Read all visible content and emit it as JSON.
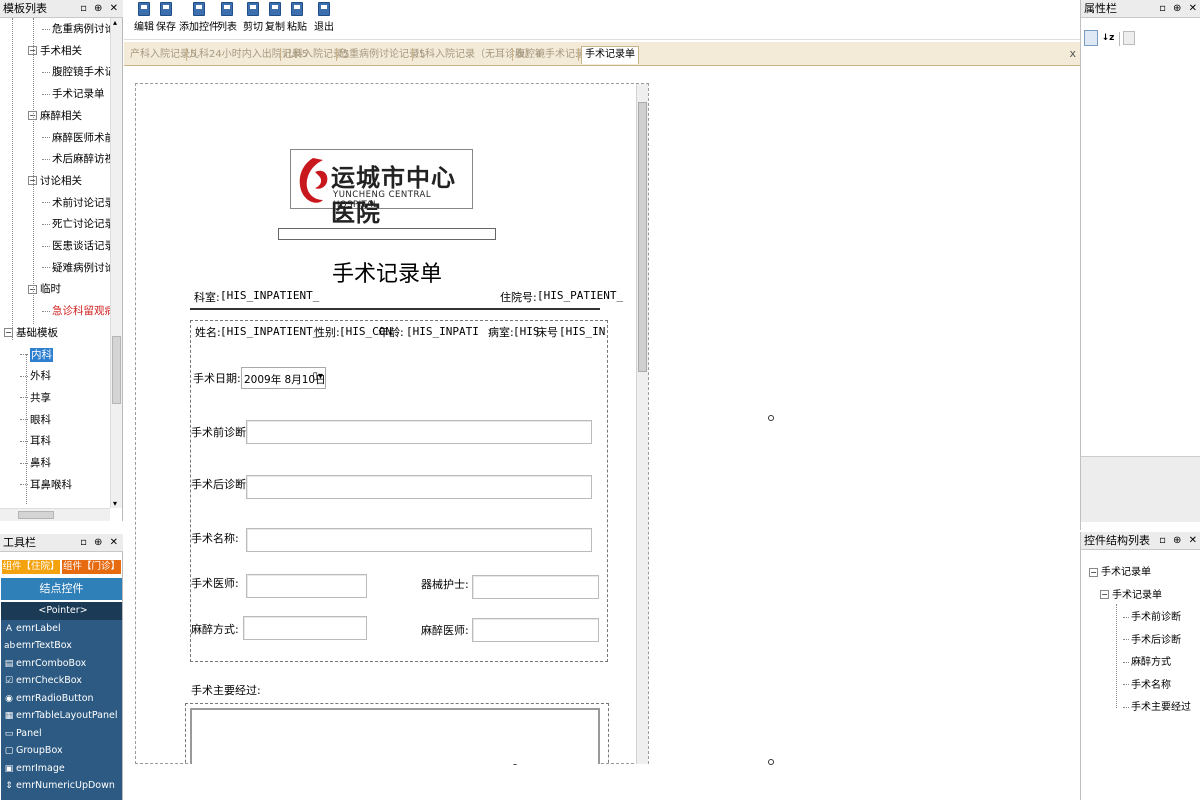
{
  "left_panel": {
    "title": "模板列表",
    "tree": [
      {
        "label": "危重病例讨论记录",
        "level": 2
      },
      {
        "label": "手术相关",
        "level": 1,
        "expander": "−"
      },
      {
        "label": "腹腔镜手术记录单",
        "level": 2
      },
      {
        "label": "手术记录单",
        "level": 2
      },
      {
        "label": "麻醉相关",
        "level": 1,
        "expander": "−"
      },
      {
        "label": "麻醉医师术前访视",
        "level": 2
      },
      {
        "label": "术后麻醉访视记录",
        "level": 2
      },
      {
        "label": "讨论相关",
        "level": 1,
        "expander": "−"
      },
      {
        "label": "术前讨论记录",
        "level": 2
      },
      {
        "label": "死亡讨论记录",
        "level": 2
      },
      {
        "label": "医患谈话记录",
        "level": 2
      },
      {
        "label": "疑难病例讨论记录",
        "level": 2
      },
      {
        "label": "临时",
        "level": 1,
        "expander": "−"
      },
      {
        "label": "急诊科留观病历",
        "level": 2,
        "color": "#d02020"
      },
      {
        "label": "基础模板",
        "level": 0,
        "expander": "−"
      },
      {
        "label": "内科",
        "level": 1,
        "selected": true
      },
      {
        "label": "外科",
        "level": 1
      },
      {
        "label": "共享",
        "level": 1
      },
      {
        "label": "眼科",
        "level": 1
      },
      {
        "label": "耳科",
        "level": 1
      },
      {
        "label": "鼻科",
        "level": 1
      },
      {
        "label": "耳鼻喉科",
        "level": 1
      }
    ]
  },
  "toolbox": {
    "title": "工具栏",
    "tab_inpatient": "组件【住院】",
    "tab_outpatient": "组件【门诊】",
    "header": "结点控件",
    "items": [
      {
        "label": "<Pointer>",
        "icon": ""
      },
      {
        "label": "emrLabel",
        "icon": "A"
      },
      {
        "label": "emrTextBox",
        "icon": "ab"
      },
      {
        "label": "emrComboBox",
        "icon": "▤"
      },
      {
        "label": "emrCheckBox",
        "icon": "☑"
      },
      {
        "label": "emrRadioButton",
        "icon": "◉"
      },
      {
        "label": "emrTableLayoutPanel",
        "icon": "▦"
      },
      {
        "label": "Panel",
        "icon": "▭"
      },
      {
        "label": "GroupBox",
        "icon": "▢"
      },
      {
        "label": "emrImage",
        "icon": "▣"
      },
      {
        "label": "emrNumericUpDown",
        "icon": "⇕"
      }
    ]
  },
  "toolbar": {
    "buttons": [
      "编辑",
      "保存",
      "添加控件",
      "列表",
      "剪切",
      "复制",
      "粘贴",
      "退出"
    ]
  },
  "doc_tabs": {
    "tabs": [
      "产科入院记录5",
      "儿科24小时内入出院记录5",
      "儿科入院记录5",
      "危重病例讨论记录5",
      "儿科入院记录（无耳诊表）4",
      "腹腔镜手术记录单",
      "手术记录单"
    ],
    "active_index": 6,
    "close": "x"
  },
  "document": {
    "logo_cn": "运城市中心医院",
    "logo_en": "YUNCHENG CENTRAL HOSPITAL",
    "title": "手术记录单",
    "dept_label": "科室:",
    "dept_value": "[HIS_INPATIENT_",
    "admission_label": "住院号:",
    "admission_value": "[HIS_PATIENT_",
    "name_label": "姓名:",
    "name_value": "[HIS_INPATIENT_",
    "gender_label": "性别:",
    "gender_value": "[HIS_CON",
    "age_label": "年龄:",
    "age_value": "[HIS_INPATI",
    "ward_label": "病室:",
    "ward_value": "[HIS",
    "bed_label": "床号",
    "bed_value": "[HIS_IN",
    "date_label": "手术日期:",
    "date_value": "2009年  8月10日",
    "preop_label": "手术前诊断:",
    "postop_label": "手术后诊断:",
    "surgery_name_label": "手术名称:",
    "surgeon_label": "手术医师:",
    "nurse_label": "器械护士:",
    "anesthesia_method_label": "麻醉方式:",
    "anesthetist_label": "麻醉医师:",
    "process_label": "手术主要经过:"
  },
  "properties_panel": {
    "title": "属性栏"
  },
  "structure_panel": {
    "title": "控件结构列表",
    "tree": [
      {
        "label": "手术记录单",
        "level": 0,
        "expander": "−"
      },
      {
        "label": "手术记录单",
        "level": 1,
        "expander": "−"
      },
      {
        "label": "手术前诊断",
        "level": 2
      },
      {
        "label": "手术后诊断",
        "level": 2
      },
      {
        "label": "麻醉方式",
        "level": 2
      },
      {
        "label": "手术名称",
        "level": 2
      },
      {
        "label": "手术主要经过",
        "level": 2
      }
    ]
  },
  "colors": {
    "toolbox_bg": "#2c5a82",
    "toolbox_header": "#2f7fb8",
    "tab_inpatient": "#f3a10c",
    "tab_outpatient": "#e66a10",
    "doc_tab_bar": "#f3ead8",
    "selection": "#2f7fd0"
  }
}
